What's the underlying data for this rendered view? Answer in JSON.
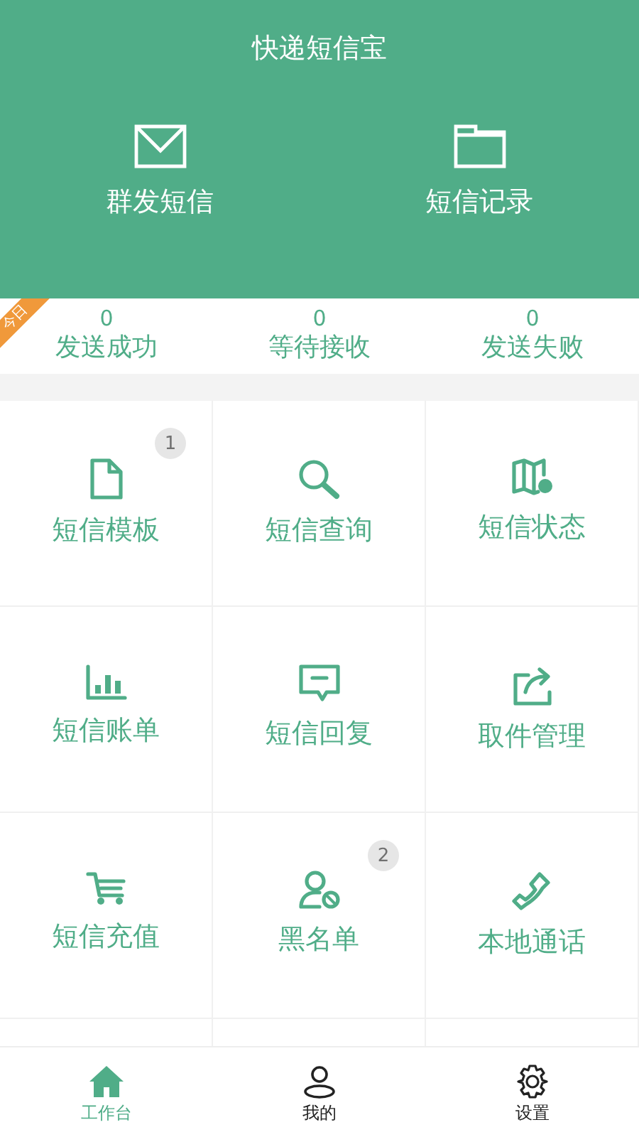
{
  "header": {
    "title": "快递短信宝",
    "actions": [
      {
        "label": "群发短信"
      },
      {
        "label": "短信记录"
      }
    ]
  },
  "today_tag": "今日",
  "stats": [
    {
      "value": "0",
      "label": "发送成功"
    },
    {
      "value": "0",
      "label": "等待接收"
    },
    {
      "value": "0",
      "label": "发送失败"
    }
  ],
  "tiles": [
    {
      "label": "短信模板",
      "badge": "1"
    },
    {
      "label": "短信查询"
    },
    {
      "label": "短信状态"
    },
    {
      "label": "短信账单"
    },
    {
      "label": "短信回复"
    },
    {
      "label": "取件管理"
    },
    {
      "label": "短信充值"
    },
    {
      "label": "黑名单",
      "badge": "2"
    },
    {
      "label": "本地通话"
    }
  ],
  "tab_bar": [
    {
      "label": "工作台",
      "selected": true
    },
    {
      "label": "我的",
      "selected": false
    },
    {
      "label": "设置",
      "selected": false
    }
  ]
}
